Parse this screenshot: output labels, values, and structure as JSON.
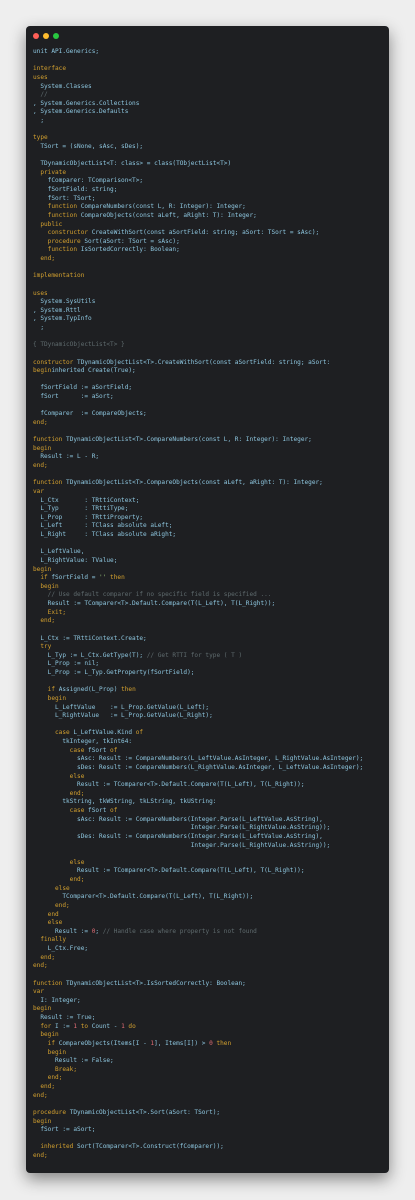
{
  "window": {
    "controls": [
      "close",
      "minimize",
      "maximize"
    ],
    "colors": {
      "background": "#1e1f22",
      "keyword": "#d3a02f",
      "text": "#8ec7e0",
      "comment": "#5f6b6e",
      "number": "#e06c75",
      "string": "#98c379",
      "close": "#ff5f57",
      "minimize": "#febc2e",
      "maximize": "#28c840"
    }
  },
  "editor": {
    "language": "Delphi / Object Pascal",
    "lines": [
      [
        [
          "tx",
          "unit API.Generics;"
        ]
      ],
      [],
      [
        [
          "kw",
          "interface"
        ]
      ],
      [
        [
          "kw",
          "uses"
        ]
      ],
      [
        [
          "tx",
          "  System.Classes"
        ]
      ],
      [
        [
          "cm",
          "  //"
        ]
      ],
      [
        [
          "tx",
          ", System.Generics.Collections"
        ]
      ],
      [
        [
          "tx",
          ", System.Generics.Defaults"
        ]
      ],
      [
        [
          "tx",
          "  ;"
        ]
      ],
      [],
      [
        [
          "kw",
          "type"
        ]
      ],
      [
        [
          "tx",
          "  TSort = (sNone, sAsc, sDes);"
        ]
      ],
      [],
      [
        [
          "tx",
          "  TDynamicObjectList<T: class> = class(TObjectList<T>)"
        ]
      ],
      [
        [
          "kw",
          "  private"
        ]
      ],
      [
        [
          "tx",
          "    fComparer: TComparison<T>;"
        ]
      ],
      [
        [
          "tx",
          "    fSortField: string;"
        ]
      ],
      [
        [
          "tx",
          "    fSort: TSort;"
        ]
      ],
      [
        [
          "kw",
          "    function "
        ],
        [
          "tx",
          "CompareNumbers(const L, R: Integer): Integer;"
        ]
      ],
      [
        [
          "kw",
          "    function "
        ],
        [
          "tx",
          "CompareObjects(const aLeft, aRight: T): Integer;"
        ]
      ],
      [
        [
          "kw",
          "  public"
        ]
      ],
      [
        [
          "kw",
          "    constructor "
        ],
        [
          "tx",
          "CreateWithSort(const aSortField: string; aSort: TSort = sAsc);"
        ]
      ],
      [
        [
          "kw",
          "    procedure "
        ],
        [
          "tx",
          "Sort(aSort: TSort = sAsc);"
        ]
      ],
      [
        [
          "kw",
          "    function "
        ],
        [
          "tx",
          "IsSortedCorrectly: Boolean;"
        ]
      ],
      [
        [
          "kw",
          "  end;"
        ]
      ],
      [],
      [
        [
          "kw",
          "implementation"
        ]
      ],
      [],
      [
        [
          "kw",
          "uses"
        ]
      ],
      [
        [
          "tx",
          "  System.SysUtils"
        ]
      ],
      [
        [
          "tx",
          ", System.Rttl"
        ]
      ],
      [
        [
          "tx",
          ", System.TypInfo"
        ]
      ],
      [
        [
          "tx",
          "  ;"
        ]
      ],
      [],
      [
        [
          "cm",
          "{ TDynamicObjectList<T> }"
        ]
      ],
      [],
      [
        [
          "kw",
          "constructor "
        ],
        [
          "tx",
          "TDynamicObjectList<T>.CreateWithSort(const aSortField: string; aSort:"
        ]
      ],
      [
        [
          "kw",
          "begin"
        ],
        [
          "tx",
          "inherited Create(True);"
        ]
      ],
      [],
      [
        [
          "tx",
          "  fSortField := aSortField;"
        ]
      ],
      [
        [
          "tx",
          "  fSort      := aSort;"
        ]
      ],
      [],
      [
        [
          "tx",
          "  fComparer  := CompareObjects;"
        ]
      ],
      [
        [
          "kw",
          "end;"
        ]
      ],
      [],
      [
        [
          "kw",
          "function "
        ],
        [
          "tx",
          "TDynamicObjectList<T>.CompareNumbers(const L, R: Integer): Integer;"
        ]
      ],
      [
        [
          "kw",
          "begin"
        ]
      ],
      [
        [
          "tx",
          "  Result := L - R;"
        ]
      ],
      [
        [
          "kw",
          "end;"
        ]
      ],
      [],
      [
        [
          "kw",
          "function "
        ],
        [
          "tx",
          "TDynamicObjectList<T>.CompareObjects(const aLeft, aRight: T): Integer;"
        ]
      ],
      [
        [
          "kw",
          "var"
        ]
      ],
      [
        [
          "tx",
          "  L_Ctx       : TRttiContext;"
        ]
      ],
      [
        [
          "tx",
          "  L_Typ       : TRttiType;"
        ]
      ],
      [
        [
          "tx",
          "  L_Prop      : TRttiProperty;"
        ]
      ],
      [
        [
          "tx",
          "  L_Left      : TClass absolute aLeft;"
        ]
      ],
      [
        [
          "tx",
          "  L_Right     : TClass absolute aRight;"
        ]
      ],
      [],
      [
        [
          "tx",
          "  L_LeftValue,"
        ]
      ],
      [
        [
          "tx",
          "  L_RightValue: TValue;"
        ]
      ],
      [
        [
          "kw",
          "begin"
        ]
      ],
      [
        [
          "kw",
          "  if "
        ],
        [
          "tx",
          "fSortField = "
        ],
        [
          "str",
          "''"
        ],
        [
          "kw",
          " then"
        ]
      ],
      [
        [
          "kw",
          "  begin"
        ]
      ],
      [
        [
          "cm",
          "    // Use default comparer if no specific field is specified ..."
        ]
      ],
      [
        [
          "tx",
          "    Result := TComparer<T>.Default.Compare(T(L_Left), T(L_Right));"
        ]
      ],
      [
        [
          "kw",
          "    Exit;"
        ]
      ],
      [
        [
          "kw",
          "  end;"
        ]
      ],
      [],
      [
        [
          "tx",
          "  L_Ctx := TRttiContext.Create;"
        ]
      ],
      [
        [
          "kw",
          "  try"
        ]
      ],
      [
        [
          "tx",
          "    L_Typ := L_Ctx.GetType(T); "
        ],
        [
          "cm",
          "// Get RTTI for type ( T )"
        ]
      ],
      [
        [
          "tx",
          "    L_Prop := nil;"
        ]
      ],
      [
        [
          "tx",
          "    L_Prop := L_Typ.GetProperty(fSortField);"
        ]
      ],
      [],
      [
        [
          "kw",
          "    if "
        ],
        [
          "tx",
          "Assigned(L_Prop) "
        ],
        [
          "kw",
          "then"
        ]
      ],
      [
        [
          "kw",
          "    begin"
        ]
      ],
      [
        [
          "tx",
          "      L_LeftValue    := L_Prop.GetValue(L_Left);"
        ]
      ],
      [
        [
          "tx",
          "      L_RightValue   := L_Prop.GetValue(L_Right);"
        ]
      ],
      [],
      [
        [
          "kw",
          "      case "
        ],
        [
          "tx",
          "L_LeftValue.Kind "
        ],
        [
          "kw",
          "of"
        ]
      ],
      [
        [
          "tx",
          "        tkInteger, tkInt64:"
        ]
      ],
      [
        [
          "kw",
          "          case "
        ],
        [
          "tx",
          "fSort "
        ],
        [
          "kw",
          "of"
        ]
      ],
      [
        [
          "tx",
          "            sAsc: Result := CompareNumbers(L_LeftValue.AsInteger, L_RightValue.AsInteger);"
        ]
      ],
      [
        [
          "tx",
          "            sDes: Result := CompareNumbers(L_RightValue.AsInteger, L_LeftValue.AsInteger);"
        ]
      ],
      [
        [
          "kw",
          "          else"
        ]
      ],
      [
        [
          "tx",
          "            Result := TComparer<T>.Default.Compare(T(L_Left), T(L_Right));"
        ]
      ],
      [
        [
          "kw",
          "          end;"
        ]
      ],
      [
        [
          "tx",
          "        tkString, tkWString, tkLString, tkUString:"
        ]
      ],
      [
        [
          "kw",
          "          case "
        ],
        [
          "tx",
          "fSort "
        ],
        [
          "kw",
          "of"
        ]
      ],
      [
        [
          "tx",
          "            sAsc: Result := CompareNumbers(Integer.Parse(L_LeftValue.AsString),"
        ]
      ],
      [
        [
          "tx",
          "                                           Integer.Parse(L_RightValue.AsString));"
        ]
      ],
      [
        [
          "tx",
          "            sDes: Result := CompareNumbers(Integer.Parse(L_LeftValue.AsString),"
        ]
      ],
      [
        [
          "tx",
          "                                           Integer.Parse(L_RightValue.AsString));"
        ]
      ],
      [],
      [
        [
          "kw",
          "          else"
        ]
      ],
      [
        [
          "tx",
          "            Result := TComparer<T>.Default.Compare(T(L_Left), T(L_Right));"
        ]
      ],
      [
        [
          "kw",
          "          end;"
        ]
      ],
      [
        [
          "kw",
          "      else"
        ]
      ],
      [
        [
          "tx",
          "        TComparer<T>.Default.Compare(T(L_Left), T(L_Right));"
        ]
      ],
      [
        [
          "kw",
          "      end;"
        ]
      ],
      [
        [
          "kw",
          "    end"
        ]
      ],
      [
        [
          "kw",
          "    else"
        ]
      ],
      [
        [
          "tx",
          "      Result := "
        ],
        [
          "num",
          "0"
        ],
        [
          "tx",
          "; "
        ],
        [
          "cm",
          "// Handle case where property is not found"
        ]
      ],
      [
        [
          "kw",
          "  finally"
        ]
      ],
      [
        [
          "tx",
          "    L_Ctx.Free;"
        ]
      ],
      [
        [
          "kw",
          "  end;"
        ]
      ],
      [
        [
          "kw",
          "end;"
        ]
      ],
      [],
      [
        [
          "kw",
          "function "
        ],
        [
          "tx",
          "TDynamicObjectList<T>.IsSortedCorrectly: Boolean;"
        ]
      ],
      [
        [
          "kw",
          "var"
        ]
      ],
      [
        [
          "tx",
          "  I: Integer;"
        ]
      ],
      [
        [
          "kw",
          "begin"
        ]
      ],
      [
        [
          "tx",
          "  Result := True;"
        ]
      ],
      [
        [
          "kw",
          "  for "
        ],
        [
          "tx",
          "I := "
        ],
        [
          "num",
          "1"
        ],
        [
          "kw",
          " to "
        ],
        [
          "tx",
          "Count - "
        ],
        [
          "num",
          "1"
        ],
        [
          "kw",
          " do"
        ]
      ],
      [
        [
          "kw",
          "  begin"
        ]
      ],
      [
        [
          "kw",
          "    if "
        ],
        [
          "tx",
          "CompareObjects(Items[I - "
        ],
        [
          "num",
          "1"
        ],
        [
          "tx",
          "], Items[I]) > "
        ],
        [
          "num",
          "0"
        ],
        [
          "kw",
          " then"
        ]
      ],
      [
        [
          "kw",
          "    begin"
        ]
      ],
      [
        [
          "tx",
          "      Result := False;"
        ]
      ],
      [
        [
          "kw",
          "      Break;"
        ]
      ],
      [
        [
          "kw",
          "    end;"
        ]
      ],
      [
        [
          "kw",
          "  end;"
        ]
      ],
      [
        [
          "kw",
          "end;"
        ]
      ],
      [],
      [
        [
          "kw",
          "procedure "
        ],
        [
          "tx",
          "TDynamicObjectList<T>.Sort(aSort: TSort);"
        ]
      ],
      [
        [
          "kw",
          "begin"
        ]
      ],
      [
        [
          "tx",
          "  fSort := aSort;"
        ]
      ],
      [],
      [
        [
          "kw",
          "  inherited "
        ],
        [
          "tx",
          "Sort(TComparer<T>.Construct(fComparer));"
        ]
      ],
      [
        [
          "kw",
          "end;"
        ]
      ],
      [],
      [
        [
          "kw",
          "end."
        ]
      ]
    ]
  }
}
